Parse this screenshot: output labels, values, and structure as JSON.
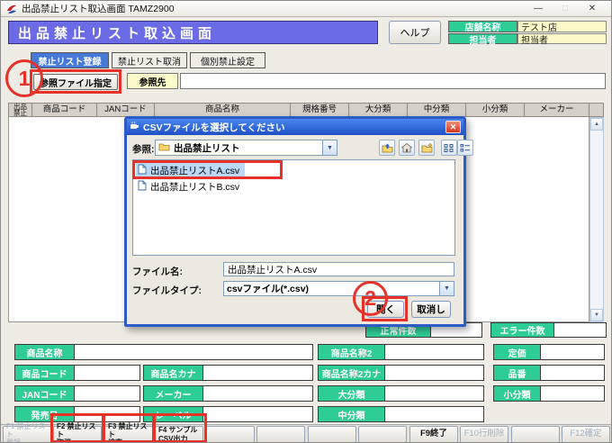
{
  "titlebar": {
    "title": "出品禁止リスト取込画面 TAMZ2900",
    "minimize": "—",
    "maximize": "□",
    "close": "✕"
  },
  "header": {
    "banner_title": "出品禁止リスト取込画面",
    "help_button": "ヘルプ",
    "store_label": "店舗名称",
    "store_value": "テスト店",
    "staff_label": "担当者",
    "staff_value": "担当者"
  },
  "tabs": [
    {
      "label": "禁止リスト登録",
      "active": true
    },
    {
      "label": "禁止リスト取消",
      "active": false
    },
    {
      "label": "個別禁止設定",
      "active": false
    }
  ],
  "browse_row": {
    "browse_button": "参照ファイル指定",
    "path_label": "参照先",
    "path_value": ""
  },
  "table": {
    "col0_line1": "出品",
    "col0_line2": "禁止",
    "columns": [
      "商品コード",
      "JANコード",
      "商品名称",
      "規格番号",
      "大分類",
      "中分類",
      "小分類",
      "メーカー"
    ]
  },
  "dialog": {
    "title": "CSVファイルを選択してください",
    "look_in_label": "参照:",
    "look_in_value": "出品禁止リスト",
    "toolbar_icons": [
      "up-folder-icon",
      "home-icon",
      "new-folder-icon",
      "list-view-icon",
      "details-view-icon"
    ],
    "files": [
      {
        "name": "出品禁止リストA.csv",
        "selected": true
      },
      {
        "name": "出品禁止リストB.csv",
        "selected": false
      }
    ],
    "file_name_label": "ファイル名:",
    "file_name_value": "出品禁止リストA.csv",
    "file_type_label": "ファイルタイプ:",
    "file_type_value": "csvファイル(*.csv)",
    "open_button": "開く",
    "cancel_button": "取消し"
  },
  "counts": {
    "normal_label": "正常件数",
    "normal_value": "",
    "error_label": "エラー件数",
    "error_value": ""
  },
  "form": {
    "product_name": {
      "label": "商品名称",
      "value": ""
    },
    "product_code": {
      "label": "商品コード",
      "value": ""
    },
    "product_kana": {
      "label": "商品名カナ",
      "value": ""
    },
    "jan_code": {
      "label": "JANコード",
      "value": ""
    },
    "maker": {
      "label": "メーカー",
      "value": ""
    },
    "release_date": {
      "label": "発売日",
      "value": ""
    },
    "record_label": {
      "label": "レーベル",
      "value": ""
    },
    "product_name2": {
      "label": "商品名称2",
      "value": ""
    },
    "product_name2_kana": {
      "label": "商品名称2カナ",
      "value": ""
    },
    "category_large": {
      "label": "大分類",
      "value": ""
    },
    "category_middle": {
      "label": "中分類",
      "value": ""
    },
    "price": {
      "label": "定価",
      "value": ""
    },
    "item_number": {
      "label": "品番",
      "value": ""
    },
    "category_small": {
      "label": "小分類",
      "value": ""
    }
  },
  "fkeys": [
    {
      "line1": "F1 禁止リスト",
      "line2": "登録",
      "enabled": false
    },
    {
      "line1": "F2 禁止リスト",
      "line2": "取消",
      "enabled": true
    },
    {
      "line1": "F3 禁止リスト",
      "line2": "検索",
      "enabled": true
    },
    {
      "line1": "F4 サンプル",
      "line2": "CSV出力",
      "enabled": true
    },
    {
      "line1": "",
      "line2": "",
      "enabled": false
    },
    {
      "line1": "",
      "line2": "",
      "enabled": false
    },
    {
      "line1": "",
      "line2": "",
      "enabled": false
    },
    {
      "line1": "",
      "line2": "",
      "enabled": false
    },
    {
      "line1": "F9終了",
      "line2": "",
      "enabled": true
    },
    {
      "line1": "F10行削除",
      "line2": "",
      "enabled": false
    },
    {
      "line1": "",
      "line2": "",
      "enabled": false
    },
    {
      "line1": "F12確定",
      "line2": "",
      "enabled": false
    }
  ],
  "annotations": {
    "step1": "1",
    "step2": "2",
    "color": "#E63229"
  },
  "colors": {
    "accent_green": "#2FCD96",
    "banner_blue": "#6B6BE5",
    "tab_blue": "#4779D9",
    "field_yellow": "#FBFBC9",
    "selection_blue": "#BBD9F7",
    "dialog_title_blue": "#2B5CC8",
    "annotation_red": "#E63229"
  }
}
